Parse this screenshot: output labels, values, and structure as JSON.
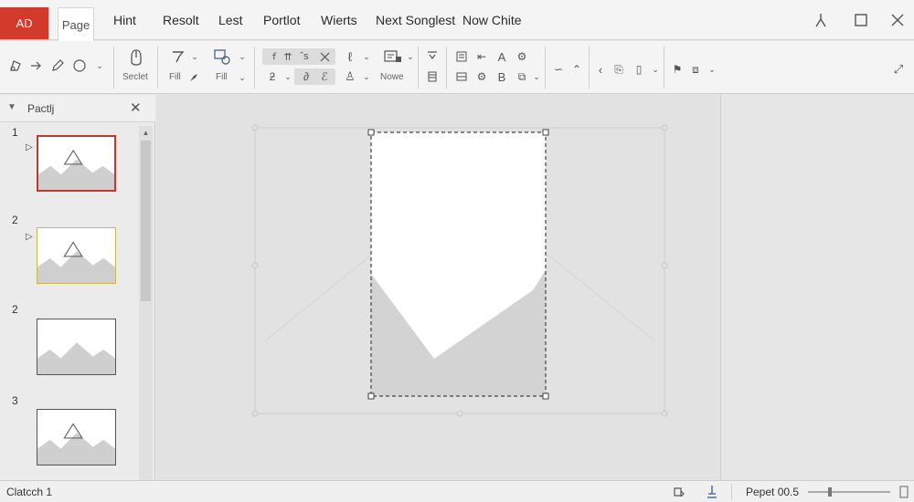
{
  "app": {
    "logo": "AD",
    "accent": "#d43a2c"
  },
  "menu": {
    "tabs": [
      "Page",
      "Hint",
      "Resolt",
      "Lest",
      "Portlot",
      "Wierts",
      "Next Songlest",
      "Now Chite"
    ],
    "active_tab": "Page"
  },
  "window": {
    "buttons": [
      "pin-icon",
      "maximize-icon",
      "close-icon"
    ]
  },
  "ribbon": {
    "select_label": "Seclet",
    "fill_label": "Fill",
    "fill2_label": "Fill",
    "move_label": "Nowe"
  },
  "pane": {
    "title": "Pactlj",
    "slides": [
      {
        "number": "1"
      },
      {
        "number": "2"
      },
      {
        "number": "2"
      },
      {
        "number": "3"
      }
    ]
  },
  "status": {
    "left_text": "Clatcch 1",
    "zoom_text": "Pepet 00.5",
    "zoom_level": 0.25
  }
}
